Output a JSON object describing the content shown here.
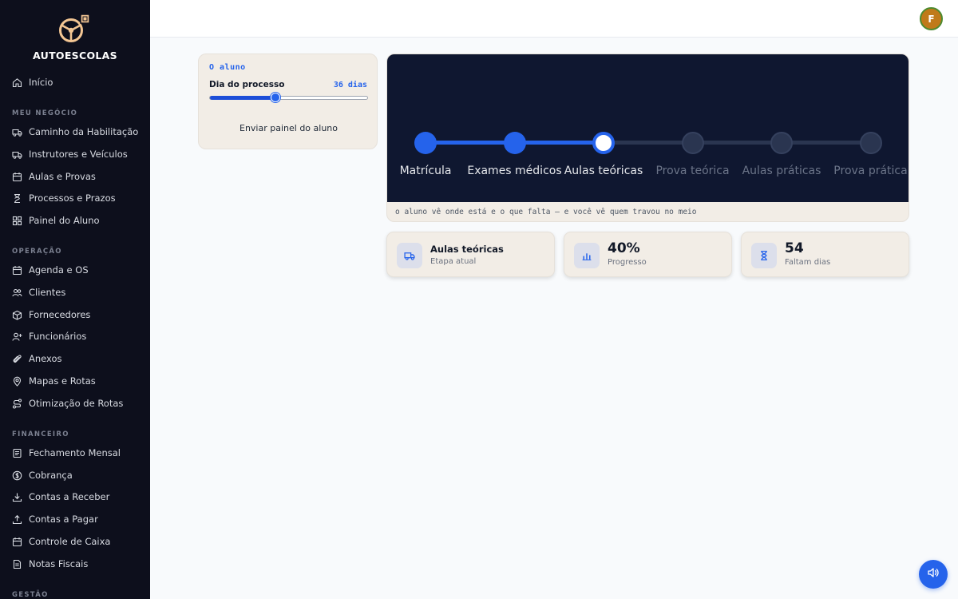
{
  "brand": {
    "name": "AUTOESCOLAS"
  },
  "sidebar": {
    "home": {
      "label": "Início",
      "icon": "home-icon"
    },
    "sections": [
      {
        "title": "MEU NEGÓCIO",
        "items": [
          {
            "label": "Caminho da Habilitação",
            "icon": "truck-icon"
          },
          {
            "label": "Instrutores e Veículos",
            "icon": "truck-icon"
          },
          {
            "label": "Aulas e Provas",
            "icon": "calendar-icon"
          },
          {
            "label": "Processos e Prazos",
            "icon": "hourglass-icon"
          },
          {
            "label": "Painel do Aluno",
            "icon": "grid-icon"
          }
        ]
      },
      {
        "title": "OPERAÇÃO",
        "items": [
          {
            "label": "Agenda e OS",
            "icon": "calendar-icon"
          },
          {
            "label": "Clientes",
            "icon": "users-icon"
          },
          {
            "label": "Fornecedores",
            "icon": "box-icon"
          },
          {
            "label": "Funcionários",
            "icon": "user-plus-icon"
          },
          {
            "label": "Anexos",
            "icon": "paperclip-icon"
          },
          {
            "label": "Mapas e Rotas",
            "icon": "map-pin-icon"
          },
          {
            "label": "Otimização de Rotas",
            "icon": "route-icon"
          }
        ]
      },
      {
        "title": "FINANCEIRO",
        "items": [
          {
            "label": "Fechamento Mensal",
            "icon": "receipt-icon"
          },
          {
            "label": "Cobrança",
            "icon": "dollar-circle-icon"
          },
          {
            "label": "Contas a Receber",
            "icon": "download-icon"
          },
          {
            "label": "Contas a Pagar",
            "icon": "upload-icon"
          },
          {
            "label": "Controle de Caixa",
            "icon": "cash-register-icon"
          },
          {
            "label": "Notas Fiscais",
            "icon": "document-icon"
          }
        ]
      },
      {
        "title": "GESTÃO",
        "items": []
      }
    ]
  },
  "topbar": {
    "avatar_initial": "F"
  },
  "student_card": {
    "title": "O aluno",
    "day_label": "Dia do processo",
    "days_text": "36 dias",
    "progress": 0.41,
    "send_label": "Enviar painel do aluno"
  },
  "journey": {
    "steps": [
      {
        "label": "Matrícula",
        "state": "done"
      },
      {
        "label": "Exames médicos",
        "state": "done"
      },
      {
        "label": "Aulas teóricas",
        "state": "current"
      },
      {
        "label": "Prova teórica",
        "state": "pending"
      },
      {
        "label": "Aulas práticas",
        "state": "pending"
      },
      {
        "label": "Prova prática",
        "state": "pending"
      }
    ],
    "caption": "o aluno vê onde está e o que falta — e você vê quem travou no meio"
  },
  "stats": [
    {
      "value": "Aulas teóricas",
      "sub": "Etapa atual",
      "icon": "truck-icon"
    },
    {
      "value": "40%",
      "sub": "Progresso",
      "icon": "bar-chart-icon"
    },
    {
      "value": "54",
      "sub": "Faltam dias",
      "icon": "hourglass-icon"
    }
  ],
  "colors": {
    "accent": "#2563eb",
    "sidebar_bg": "#0d0f1c",
    "journey_bg": "#0f1730",
    "pending": "#2a3550"
  },
  "fab": {
    "icon": "speaker-icon"
  }
}
